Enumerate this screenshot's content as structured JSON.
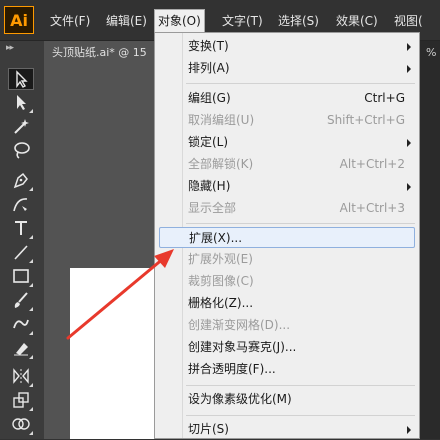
{
  "app": {
    "logo_text": "Ai"
  },
  "menubar": {
    "items": [
      "文件(F)",
      "编辑(E)",
      "对象(O)",
      "文字(T)",
      "选择(S)",
      "效果(C)",
      "视图("
    ],
    "active_index": 2
  },
  "document": {
    "tab_title": "头顶贴纸.ai* @ 15",
    "zoom_fragment": "%"
  },
  "tools": [
    "selection-tool",
    "direct-selection-tool",
    "magic-wand-tool",
    "lasso-tool",
    "pen-tool",
    "curvature-tool",
    "type-tool",
    "line-segment-tool",
    "rectangle-tool",
    "paintbrush-tool",
    "shaper-tool",
    "eraser-tool",
    "rotate-tool",
    "width-tool",
    "free-transform-tool",
    "shape-builder-tool"
  ],
  "object_menu": {
    "groups": [
      [
        {
          "label": "变换(T)",
          "shortcut": "",
          "submenu": true,
          "disabled": false
        },
        {
          "label": "排列(A)",
          "shortcut": "",
          "submenu": true,
          "disabled": false
        }
      ],
      [
        {
          "label": "编组(G)",
          "shortcut": "Ctrl+G",
          "submenu": false,
          "disabled": false
        },
        {
          "label": "取消编组(U)",
          "shortcut": "Shift+Ctrl+G",
          "submenu": false,
          "disabled": true
        },
        {
          "label": "锁定(L)",
          "shortcut": "",
          "submenu": true,
          "disabled": false
        },
        {
          "label": "全部解锁(K)",
          "shortcut": "Alt+Ctrl+2",
          "submenu": false,
          "disabled": true
        },
        {
          "label": "隐藏(H)",
          "shortcut": "",
          "submenu": true,
          "disabled": false
        },
        {
          "label": "显示全部",
          "shortcut": "Alt+Ctrl+3",
          "submenu": false,
          "disabled": true
        }
      ],
      [
        {
          "label": "扩展(X)...",
          "shortcut": "",
          "submenu": false,
          "disabled": false,
          "highlighted": true
        },
        {
          "label": "扩展外观(E)",
          "shortcut": "",
          "submenu": false,
          "disabled": true
        },
        {
          "label": "裁剪图像(C)",
          "shortcut": "",
          "submenu": false,
          "disabled": true
        },
        {
          "label": "栅格化(Z)...",
          "shortcut": "",
          "submenu": false,
          "disabled": false
        },
        {
          "label": "创建渐变网格(D)...",
          "shortcut": "",
          "submenu": false,
          "disabled": true
        },
        {
          "label": "创建对象马赛克(J)...",
          "shortcut": "",
          "submenu": false,
          "disabled": false
        },
        {
          "label": "拼合透明度(F)...",
          "shortcut": "",
          "submenu": false,
          "disabled": false
        }
      ],
      [
        {
          "label": "设为像素级优化(M)",
          "shortcut": "",
          "submenu": false,
          "disabled": false
        }
      ],
      [
        {
          "label": "切片(S)",
          "shortcut": "",
          "submenu": true,
          "disabled": false
        }
      ]
    ]
  },
  "colors": {
    "annotation_arrow": "#e8392c",
    "accent": "#ff9a00"
  }
}
